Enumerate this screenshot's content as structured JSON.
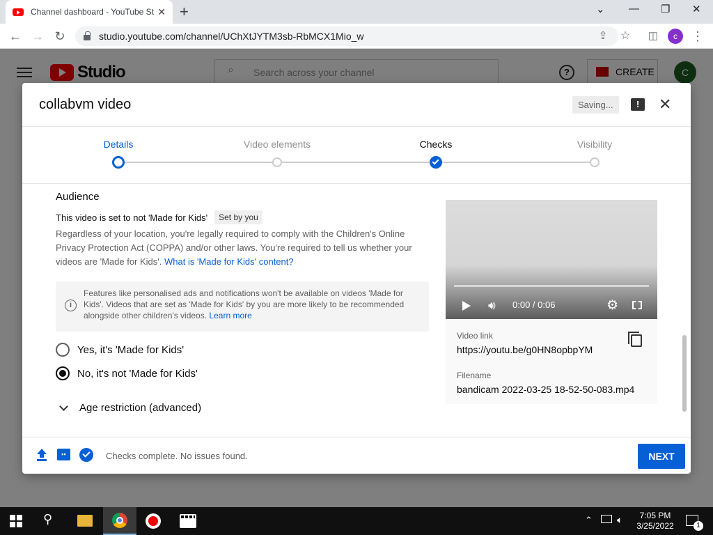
{
  "browser": {
    "tab_title": "Channel dashboard - YouTube St",
    "url": "studio.youtube.com/channel/UChXtJYTM3sb-RbMCX1Mio_w",
    "profile_initial": "c"
  },
  "studio": {
    "logo": "Studio",
    "search_placeholder": "Search across your channel",
    "create_label": "CREATE",
    "avatar_initial": "C"
  },
  "modal": {
    "title": "collabvm video",
    "saving": "Saving...",
    "steps": [
      {
        "label": "Details",
        "state": "current"
      },
      {
        "label": "Video elements",
        "state": "pending"
      },
      {
        "label": "Checks",
        "state": "done"
      },
      {
        "label": "Visibility",
        "state": "pending"
      }
    ],
    "audience": {
      "heading": "Audience",
      "status": "This video is set to not 'Made for Kids'",
      "chip": "Set by you",
      "paragraph": "Regardless of your location, you're legally required to comply with the Children's Online Privacy Protection Act (COPPA) and/or other laws. You're required to tell us whether your videos are 'Made for Kids'.",
      "paragraph_link": "What is 'Made for Kids' content?",
      "info": "Features like personalised ads and notifications won't be available on videos 'Made for Kids'. Videos that are set as 'Made for Kids' by you are more likely to be recommended alongside other children's videos.",
      "info_link": "Learn more",
      "option_yes": "Yes, it's 'Made for Kids'",
      "option_no": "No, it's not 'Made for Kids'",
      "selected": "no",
      "age_restriction": "Age restriction (advanced)"
    },
    "video": {
      "time": "0:00 / 0:06",
      "link_label": "Video link",
      "link": "https://youtu.be/g0HN8opbpYM",
      "filename_label": "Filename",
      "filename": "bandicam 2022-03-25 18-52-50-083.mp4"
    },
    "footer": {
      "status": "Checks complete. No issues found.",
      "next": "NEXT"
    }
  },
  "taskbar": {
    "time": "7:05 PM",
    "date": "3/25/2022",
    "notification_count": "1"
  },
  "colors": {
    "accent": "#065fd4",
    "brand": "#ff0000",
    "create_icon": "#cc0000"
  }
}
